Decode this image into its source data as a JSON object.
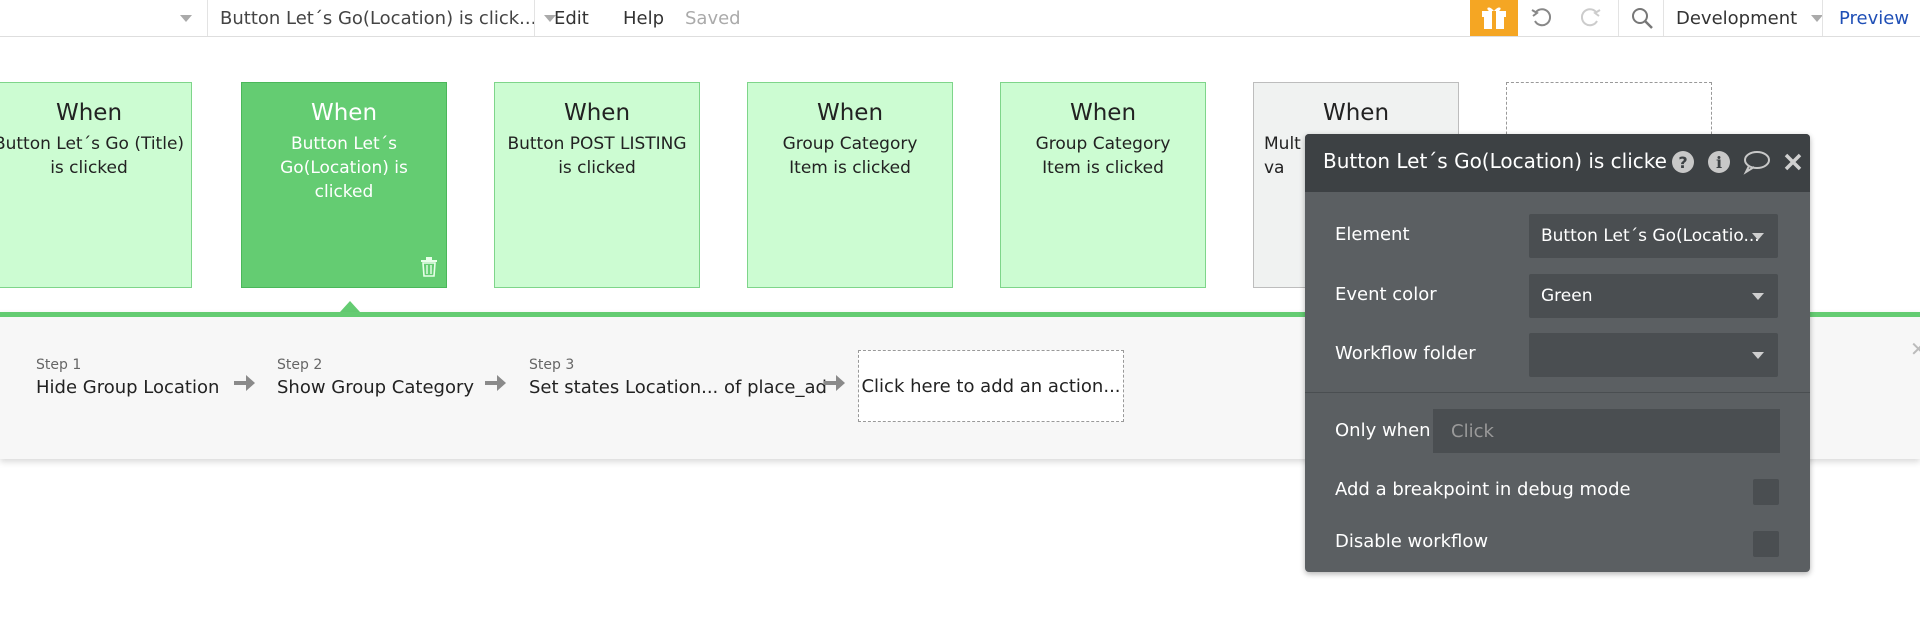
{
  "topbar": {
    "workflow_selector": "Button Let´s Go(Location) is click...",
    "menu_edit": "Edit",
    "menu_help": "Help",
    "status": "Saved",
    "environment": "Development",
    "preview": "Preview",
    "accent": "#f5a623",
    "link_color": "#1f4fb6"
  },
  "events": [
    {
      "when": "When",
      "desc": "Button Let´s Go (Title) is clicked"
    },
    {
      "when": "When",
      "desc": "Button Let´s Go(Location) is clicked"
    },
    {
      "when": "When",
      "desc": "Button POST LISTING is clicked"
    },
    {
      "when": "When",
      "desc": "Group Category Item is clicked"
    },
    {
      "when": "When",
      "desc": "Group Category Item is clicked"
    },
    {
      "when": "When",
      "desc": "Mult va"
    }
  ],
  "steps": [
    {
      "num": "Step 1",
      "name": "Hide Group Location"
    },
    {
      "num": "Step 2",
      "name": "Show Group Category"
    },
    {
      "num": "Step 3",
      "name": "Set states Location... of place_ad"
    }
  ],
  "add_action": "Click here to add an action...",
  "panel": {
    "title": "Button Let´s Go(Location) is clicke",
    "element_label": "Element",
    "element_value": "Button Let´s Go(Locatio...",
    "event_color_label": "Event color",
    "event_color_value": "Green",
    "workflow_folder_label": "Workflow folder",
    "workflow_folder_value": "",
    "only_when_label": "Only when",
    "only_when_placeholder": "Click",
    "breakpoint_label": "Add a breakpoint in debug mode",
    "disable_label": "Disable workflow"
  },
  "colors": {
    "event_green": "#ccfcd2",
    "event_selected": "#64cc72",
    "panel_bg": "#5b5f62"
  }
}
